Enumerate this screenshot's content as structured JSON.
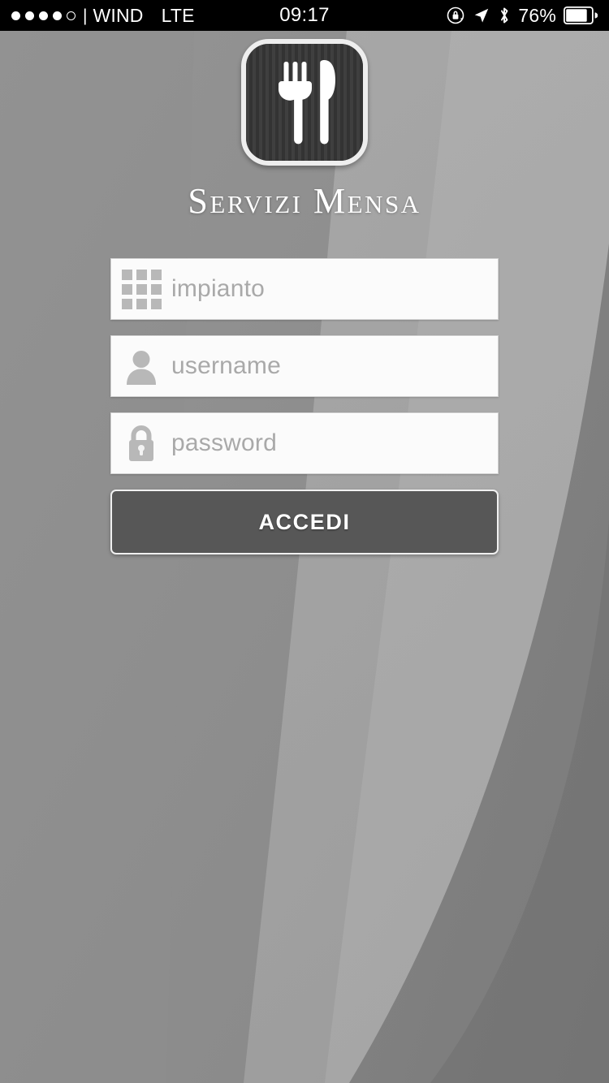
{
  "status_bar": {
    "signal_dots_filled": 4,
    "signal_dots_total": 5,
    "separator": "|",
    "carrier": "WIND",
    "network_mode": "LTE",
    "time": "09:17",
    "battery_percent": "76%",
    "icons": [
      "rotation-lock-icon",
      "location-arrow-icon",
      "bluetooth-icon",
      "battery-icon"
    ]
  },
  "branding": {
    "logo_icon": "fork-and-knife-icon",
    "app_title": "Servizi Mensa"
  },
  "login_form": {
    "fields": [
      {
        "name": "impianto",
        "icon": "grid-icon",
        "placeholder": "impianto",
        "value": ""
      },
      {
        "name": "username",
        "icon": "person-icon",
        "placeholder": "username",
        "value": ""
      },
      {
        "name": "password",
        "icon": "lock-icon",
        "placeholder": "password",
        "value": ""
      }
    ],
    "submit_label": "ACCEDI"
  },
  "theme": {
    "background_base": "#8d8d8d",
    "background_light_band": "#b3b3b3",
    "background_dark_band": "#7a7a7a",
    "status_bar_bg": "#000000",
    "button_bg": "#575757",
    "field_bg": "#fbfbfb",
    "placeholder_color": "#a9a9a9",
    "title_color": "#ffffff",
    "icon_gray": "#b8b8b8",
    "logo_dark": "#3b3b3b"
  }
}
